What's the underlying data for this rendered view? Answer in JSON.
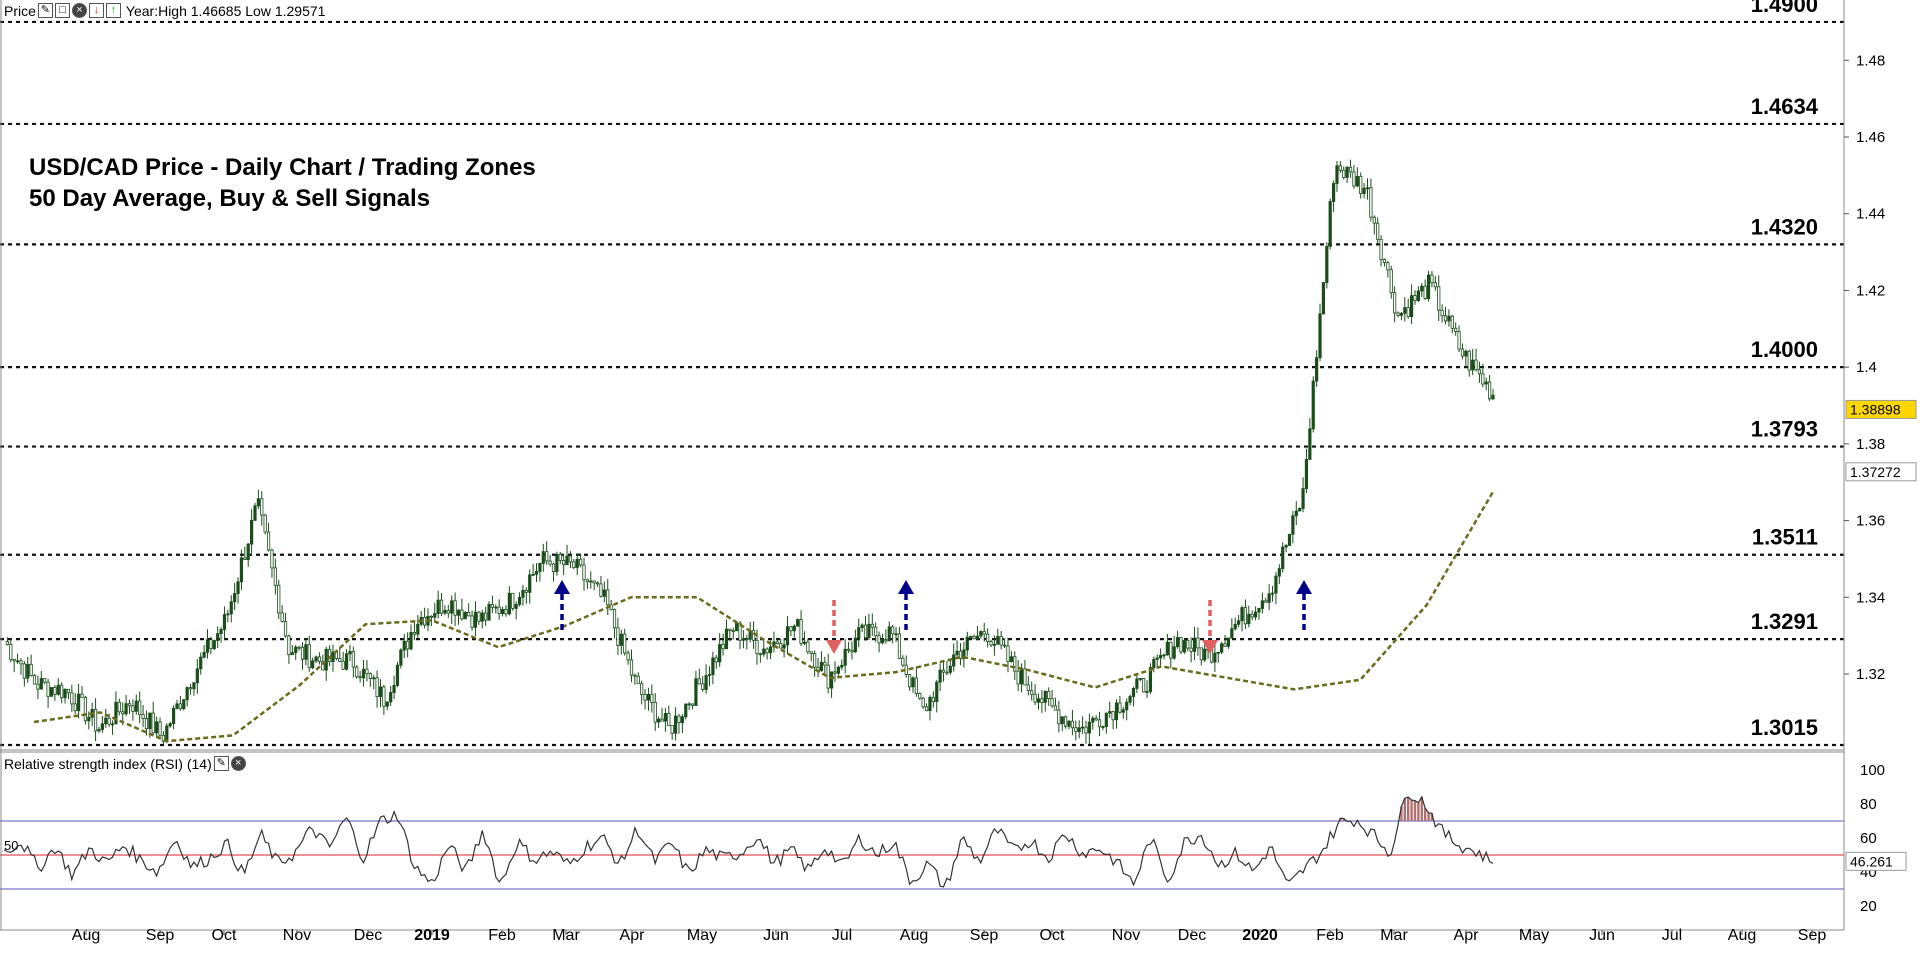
{
  "header": {
    "price_label": "Price",
    "year_range": "Year:High 1.46685 Low 1.29571",
    "icons": [
      "wrench-icon",
      "window-icon",
      "close-icon",
      "sell-arrow-icon",
      "buy-arrow-icon"
    ]
  },
  "chart_title": {
    "line1": "USD/CAD Price - Daily Chart / Trading Zones",
    "line2": "50 Day Average, Buy & Sell Signals"
  },
  "rsi_header": {
    "label": "Relative strength index (RSI) (14)",
    "icons": [
      "wrench-icon",
      "close-icon"
    ]
  },
  "colors": {
    "candle": "#1a4d1a",
    "ma": "#6b6b1e",
    "buy_arrow": "#00008b",
    "sell_arrow": "#e06060",
    "rsi_line": "#333333",
    "rsi_band": "#7777cc",
    "rsi_mid": "#e05050",
    "price_tag": "#ffd700"
  },
  "chart_data": [
    {
      "type": "candlestick",
      "series_name": "USD/CAD",
      "y_axis": {
        "ylim": [
          1.3015,
          1.4905
        ],
        "ticks": [
          "1.32",
          "1.34",
          "1.36",
          "1.38",
          "1.4",
          "1.42",
          "1.44",
          "1.46",
          "1.48"
        ]
      },
      "x_axis": {
        "labels": [
          "Aug",
          "Sep",
          "Oct",
          "Nov",
          "Dec",
          "2019",
          "Feb",
          "Mar",
          "Apr",
          "May",
          "Jun",
          "Jul",
          "Aug",
          "Sep",
          "Oct",
          "Nov",
          "Dec",
          "2020",
          "Feb",
          "Mar",
          "Apr",
          "May",
          "Jun",
          "Jul",
          "Aug",
          "Sep"
        ],
        "bold_labels": [
          "2019",
          "2020"
        ]
      },
      "price_path": [
        [
          1.333,
          1.324
        ],
        [
          1.322,
          1.313
        ],
        [
          1.328,
          1.303
        ],
        [
          1.309,
          1.303
        ],
        [
          1.321,
          1.305
        ],
        [
          1.304,
          1.303
        ],
        [
          1.316,
          1.325
        ],
        [
          1.331,
          1.337
        ],
        [
          1.362,
          1.366
        ],
        [
          1.332,
          1.321
        ],
        [
          1.336,
          1.311
        ],
        [
          1.328,
          1.319
        ],
        [
          1.313,
          1.314
        ],
        [
          1.325,
          1.343
        ],
        [
          1.337,
          1.341
        ],
        [
          1.332,
          1.336
        ],
        [
          1.339,
          1.339
        ],
        [
          1.351,
          1.348
        ],
        [
          1.345,
          1.351
        ],
        [
          1.339,
          1.338
        ],
        [
          1.321,
          1.311
        ],
        [
          1.305,
          1.306
        ],
        [
          1.314,
          1.322
        ],
        [
          1.332,
          1.332
        ],
        [
          1.326,
          1.327
        ],
        [
          1.333,
          1.332
        ],
        [
          1.322,
          1.316
        ],
        [
          1.332,
          1.328
        ],
        [
          1.329,
          1.333
        ],
        [
          1.308,
          1.312
        ],
        [
          1.324,
          1.326
        ],
        [
          1.331,
          1.332
        ],
        [
          1.323,
          1.317
        ],
        [
          1.313,
          1.31
        ],
        [
          1.309,
          1.302
        ],
        [
          1.307,
          1.315
        ],
        [
          1.313,
          1.322
        ],
        [
          1.331,
          1.327
        ],
        [
          1.331,
          1.319
        ],
        [
          1.332,
          1.336
        ],
        [
          1.344,
          1.341
        ],
        [
          1.355,
          1.378
        ],
        [
          1.445,
          1.461
        ],
        [
          1.452,
          1.441
        ],
        [
          1.407,
          1.42
        ],
        [
          1.428,
          1.415
        ],
        [
          1.408,
          1.4
        ],
        [
          1.397,
          1.389
        ]
      ],
      "moving_average_50": [
        [
          1.304,
          1.311
        ],
        [
          1.311,
          1.309
        ],
        [
          1.304,
          1.301
        ],
        [
          1.302,
          1.306
        ],
        [
          1.313,
          1.321
        ],
        [
          1.333,
          1.333
        ],
        [
          1.335,
          1.333
        ],
        [
          1.326,
          1.328
        ],
        [
          1.331,
          1.334
        ],
        [
          1.339,
          1.341
        ],
        [
          1.341,
          1.339
        ],
        [
          1.333,
          1.325
        ],
        [
          1.32,
          1.318
        ],
        [
          1.319,
          1.322
        ],
        [
          1.325,
          1.324
        ],
        [
          1.323,
          1.319
        ],
        [
          1.315,
          1.318
        ],
        [
          1.322,
          1.322
        ],
        [
          1.32,
          1.318
        ],
        [
          1.316,
          1.316
        ],
        [
          1.317,
          1.32
        ],
        [
          1.329,
          1.347
        ],
        [
          1.363,
          1.372
        ]
      ],
      "current_price_tag": "1.38898",
      "ma_price_tag": "1.37272",
      "levels": [
        {
          "label": "1.4900",
          "value": 1.49
        },
        {
          "label": "1.4634",
          "value": 1.4634
        },
        {
          "label": "1.4320",
          "value": 1.432
        },
        {
          "label": "1.4000",
          "value": 1.4
        },
        {
          "label": "1.3793",
          "value": 1.3793
        },
        {
          "label": "1.3511",
          "value": 1.3511
        },
        {
          "label": "1.3291",
          "value": 1.3291
        },
        {
          "label": "1.3015",
          "value": 1.3015
        }
      ],
      "signals": [
        {
          "direction": "buy",
          "date": "2019 Mar"
        },
        {
          "direction": "sell",
          "date": "2019 Jul"
        },
        {
          "direction": "buy",
          "date": "2019 Aug"
        },
        {
          "direction": "sell",
          "date": "2019 Dec"
        },
        {
          "direction": "buy",
          "date": "2020 Feb"
        }
      ]
    },
    {
      "type": "line",
      "series_name": "RSI (14)",
      "y_axis": {
        "ylim": [
          0,
          100
        ],
        "ticks": [
          "20",
          "40",
          "60",
          "80",
          "100"
        ]
      },
      "reference_lines": [
        30,
        50,
        70
      ],
      "left_label": "50",
      "current_value_tag": "46.261",
      "values": [
        52,
        58,
        42,
        55,
        38,
        54,
        45,
        56,
        47,
        40,
        60,
        43,
        48,
        57,
        38,
        62,
        45,
        51,
        66,
        54,
        72,
        48,
        70,
        74,
        43,
        33,
        56,
        40,
        65,
        32,
        58,
        47,
        52,
        44,
        55,
        60,
        44,
        66,
        46,
        57,
        39,
        53,
        48,
        51,
        61,
        45,
        53,
        41,
        55,
        43,
        60,
        50,
        58,
        34,
        45,
        30,
        60,
        46,
        65,
        52,
        59,
        48,
        63,
        51,
        54,
        46,
        33,
        60,
        35,
        58,
        62,
        44,
        51,
        40,
        55,
        31,
        42,
        52,
        69,
        71,
        62,
        51,
        88,
        81,
        64,
        56,
        52,
        46
      ]
    }
  ]
}
